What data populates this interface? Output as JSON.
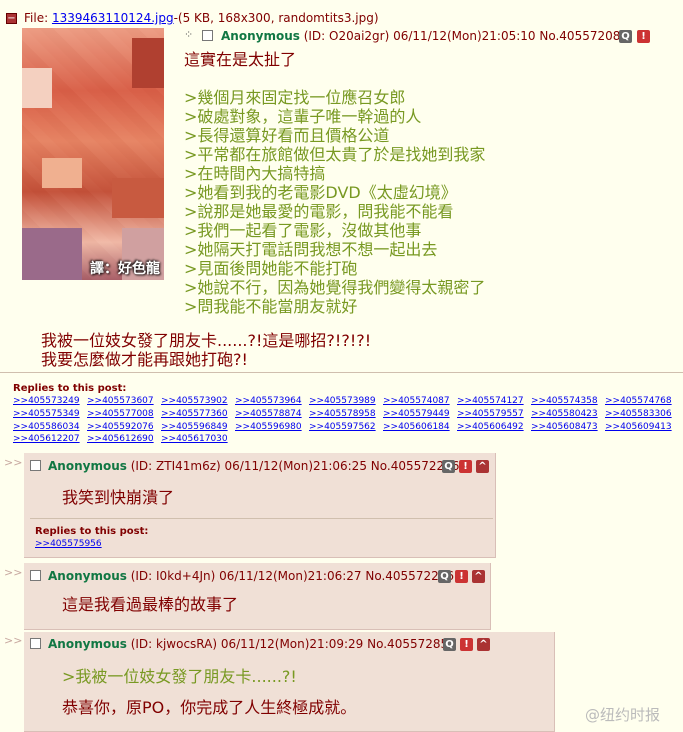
{
  "op": {
    "file_label": "File:",
    "file_name": "1339463110124.jpg",
    "file_info": "-(5 KB, 168x300, randomtits3.jpg)",
    "thumb_caption": "譯：好色龍",
    "name": "Anonymous",
    "meta": "(ID: O20ai2gr) 06/11/12(Mon)21:05:10 No.405572083",
    "lines": [
      {
        "text": "這實在是太扯了",
        "green": false
      },
      {
        "text": ">幾個月來固定找一位應召女郎",
        "green": true
      },
      {
        "text": ">破處對象，這輩子唯一幹過的人",
        "green": true
      },
      {
        "text": ">長得還算好看而且價格公道",
        "green": true
      },
      {
        "text": ">平常都在旅館做但太貴了於是找她到我家",
        "green": true
      },
      {
        "text": ">在時間內大搞特搞",
        "green": true
      },
      {
        "text": ">她看到我的老電影DVD《太虛幻境》",
        "green": true
      },
      {
        "text": ">說那是她最愛的電影，問我能不能看",
        "green": true
      },
      {
        "text": ">我們一起看了電影，沒做其他事",
        "green": true
      },
      {
        "text": ">她隔天打電話問我想不想一起出去",
        "green": true
      },
      {
        "text": ">見面後問她能不能打砲",
        "green": true
      },
      {
        "text": ">她說不行，因為她覺得我們變得太親密了",
        "green": true
      },
      {
        "text": ">問我能不能當朋友就好",
        "green": true
      }
    ],
    "tail_lines": [
      "我被一位妓女發了朋友卡......?!這是哪招?!?!?!",
      "我要怎麼做才能再跟她打砲?!"
    ],
    "replies_label": "Replies to this post:",
    "replies": [
      ">>405573249",
      ">>405573607",
      ">>405573902",
      ">>405573964",
      ">>405573989",
      ">>405574087",
      ">>405574127",
      ">>405574358",
      ">>405574768",
      ">>405575349",
      ">>405577008",
      ">>405577360",
      ">>405578874",
      ">>405578958",
      ">>405579449",
      ">>405579557",
      ">>405580423",
      ">>405583306",
      ">>405586034",
      ">>405592076",
      ">>405596849",
      ">>405596980",
      ">>405597562",
      ">>405606184",
      ">>405606492",
      ">>405608473",
      ">>405609413",
      ">>405612207",
      ">>405612690",
      ">>405617030"
    ]
  },
  "posts": [
    {
      "name": "Anonymous",
      "meta": "(ID: ZTI41m6z) 06/11/12(Mon)21:06:25 No.405572286",
      "text": "我笑到快崩潰了",
      "green": false,
      "replies_label": "Replies to this post:",
      "replies": [
        ">>405575956"
      ]
    },
    {
      "name": "Anonymous",
      "meta": "(ID: I0kd+4Jn) 06/11/12(Mon)21:06:27 No.405572296",
      "text": "這是我看過最棒的故事了",
      "green": false
    },
    {
      "name": "Anonymous",
      "meta": "(ID: kjwocsRA) 06/11/12(Mon)21:09:29 No.405572857",
      "quote": ">我被一位妓女發了朋友卡......?!",
      "text": "恭喜你，原PO，你完成了人生終極成就。"
    }
  ],
  "watermark": "@纽约时报",
  "icons": {
    "hide": "minus-icon",
    "quote": "q-icon",
    "report": "exclamation-icon",
    "up": "caret-up-icon"
  },
  "colors": {
    "bg": "#ffffee",
    "reply_bg": "#f0e0d6",
    "name": "#117743",
    "greentext": "#789922",
    "text": "#800000"
  }
}
